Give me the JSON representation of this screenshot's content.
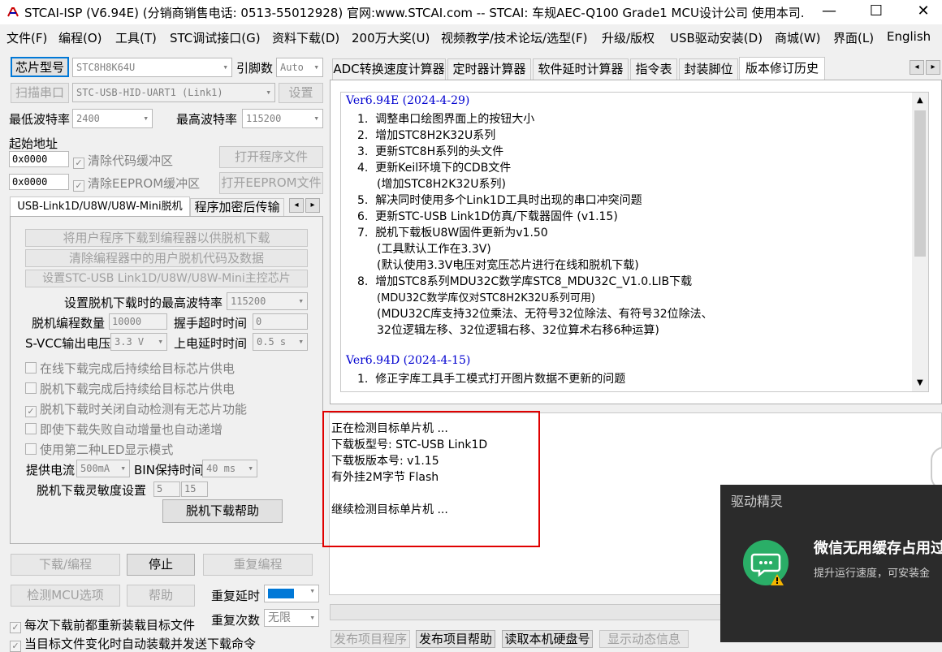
{
  "window": {
    "title": "STCAI-ISP (V6.94E) (分销商销售电话: 0513-55012928) 官网:www.STCAI.com  -- STCAI: 车规AEC-Q100 Grade1 MCU设计公司 使用本司...",
    "minimize": "—",
    "maximize": "☐",
    "close": "✕"
  },
  "menu": [
    "文件(F)",
    "编程(O)",
    "工具(T)",
    "STC调试接口(G)",
    "资料下载(D)",
    "200万大奖(U)",
    "视频教学/技术论坛/选型(F)",
    "升级/版权",
    "USB驱动安装(D)",
    "商城(W)",
    "界面(L)",
    "English"
  ],
  "left": {
    "chip_type_btn": "芯片型号",
    "chip_value": "STC8H8K64U",
    "pin_count_label": "引脚数",
    "pin_count_value": "Auto",
    "scan_port_btn": "扫描串口",
    "port_value": "STC-USB-HID-UART1 (Link1)",
    "settings_btn": "设置",
    "min_baud_label": "最低波特率",
    "min_baud_value": "2400",
    "max_baud_label": "最高波特率",
    "max_baud_value": "115200",
    "start_addr_label": "起始地址",
    "addr1": "0x0000",
    "clear_code_label": "清除代码缓冲区",
    "open_program_btn": "打开程序文件",
    "addr2": "0x0000",
    "clear_eeprom_label": "清除EEPROM缓冲区",
    "open_eeprom_btn": "打开EEPROM文件"
  },
  "offline": {
    "tab1": "USB-Link1D/U8W/U8W-Mini脱机",
    "tab2": "程序加密后传输",
    "btn_download_to_programmer": "将用户程序下载到编程器以供脱机下载",
    "btn_clear_offline": "清除编程器中的用户脱机代码及数据",
    "btn_set_master": "设置STC-USB Link1D/U8W/U8W-Mini主控芯片",
    "max_baud_label": "设置脱机下载时的最高波特率",
    "max_baud_value": "115200",
    "count_label": "脱机编程数量",
    "count_value": "10000",
    "handshake_label": "握手超时时间",
    "handshake_value": "0",
    "svcc_label": "S-VCC输出电压",
    "svcc_value": "3.3 V",
    "power_delay_label": "上电延时时间",
    "power_delay_value": "0.5 s",
    "chk1": "在线下载完成后持续给目标芯片供电",
    "chk2": "脱机下载完成后持续给目标芯片供电",
    "chk3": "脱机下载时关闭自动检测有无芯片功能",
    "chk4": "即使下载失败自动增量也自动递增",
    "chk5": "使用第二种LED显示模式",
    "current_label": "提供电流",
    "current_value": "500mA",
    "bin_hold_label": "BIN保持时间",
    "bin_hold_value": "40 ms",
    "sensitivity_label": "脱机下载灵敏度设置",
    "sens1": "5",
    "sens2": "15",
    "help_btn": "脱机下载帮助"
  },
  "bottom_left": {
    "download_btn": "下载/编程",
    "stop_btn": "停止",
    "repeat_btn": "重复编程",
    "check_mcu_btn": "检测MCU选项",
    "help_btn": "帮助",
    "repeat_delay_label": "重复延时",
    "repeat_count_label": "重复次数",
    "repeat_count_value": "无限",
    "reload_label": "每次下载前都重新装载目标文件",
    "auto_label": "当目标文件变化时自动装载并发送下载命令"
  },
  "right_tabs": [
    "ADC转换速度计算器",
    "定时器计算器",
    "软件延时计算器",
    "指令表",
    "封装脚位",
    "版本修订历史"
  ],
  "history": [
    {
      "type": "ver",
      "text": "Ver6.94E (2024-4-29)"
    },
    {
      "type": "item",
      "num": "1.",
      "text": "调整串口绘图界面上的按钮大小"
    },
    {
      "type": "item",
      "num": "2.",
      "text": "增加STC8H2K32U系列"
    },
    {
      "type": "item",
      "num": "3.",
      "text": "更新STC8H系列的头文件"
    },
    {
      "type": "item",
      "num": "4.",
      "text": "更新Keil环境下的CDB文件"
    },
    {
      "type": "sub",
      "text": "(增加STC8H2K32U系列)"
    },
    {
      "type": "item",
      "num": "5.",
      "text": "解决同时使用多个Link1D工具时出现的串口冲突问题"
    },
    {
      "type": "item",
      "num": "6.",
      "text": "更新STC-USB Link1D仿真/下载器固件 (v1.15)"
    },
    {
      "type": "item",
      "num": "7.",
      "text": "脱机下载板U8W固件更新为v1.50"
    },
    {
      "type": "sub",
      "text": "(工具默认工作在3.3V)"
    },
    {
      "type": "sub",
      "text": "(默认使用3.3V电压对宽压芯片进行在线和脱机下载)"
    },
    {
      "type": "item",
      "num": "8.",
      "text": "增加STC8系列MDU32C数学库STC8_MDU32C_V1.0.LIB下载"
    },
    {
      "type": "sub",
      "text": "(MDU32C数学库仅对STC8H2K32U系列可用)"
    },
    {
      "type": "sub",
      "text": "(MDU32C库支持32位乘法、无符号32位除法、有符号32位除法、"
    },
    {
      "type": "sub",
      "text": " 32位逻辑左移、32位逻辑右移、32位算术右移6种运算)"
    },
    {
      "type": "blank",
      "text": ""
    },
    {
      "type": "ver",
      "text": "Ver6.94D (2024-4-15)"
    },
    {
      "type": "item",
      "num": "1.",
      "text": "修正字库工具手工模式打开图片数据不更新的问题"
    }
  ],
  "log": [
    "正在检测目标单片机 ...",
    "  下载板型号: STC-USB Link1D",
    "  下载板版本号: v1.15",
    "  有外挂2M字节 Flash",
    "",
    "继续检测目标单片机 ..."
  ],
  "bottom_right_buttons": [
    "发布项目程序",
    "发布项目帮助",
    "读取本机硬盘号",
    "显示动态信息"
  ],
  "popup": {
    "title": "驱动精灵",
    "headline": "微信无用缓存占用过",
    "sub": "提升运行速度，可安装金"
  },
  "colors": {
    "accent_red": "#e00000",
    "version_blue": "#0000d0",
    "popup_bg": "#2b2b2b",
    "wechat_green": "#2aae67"
  }
}
